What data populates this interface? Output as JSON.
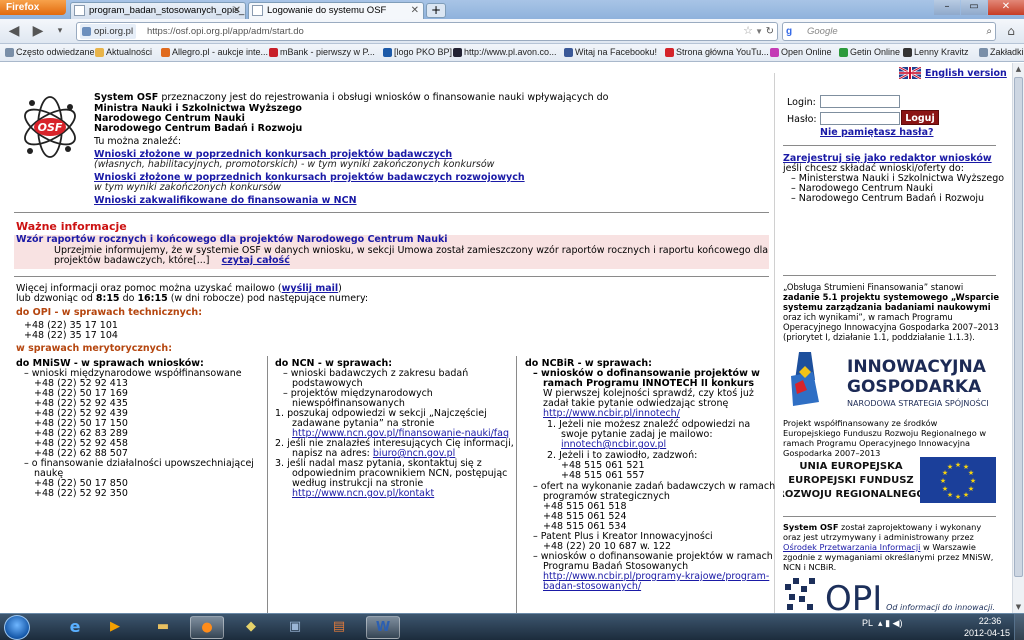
{
  "browser": {
    "app_button": "Firefox",
    "tabs": [
      {
        "label": "program_badan_stosowanych_opis_1...",
        "active": false
      },
      {
        "label": "Logowanie do systemu OSF",
        "active": true
      }
    ],
    "new_tab": "+",
    "url_site": "opi.org.pl",
    "url": "https://osf.opi.org.pl/app/adm/start.do",
    "search_engine": "Google",
    "search_placeholder": "Google",
    "bookmarks": [
      "Często odwiedzane",
      "Aktualności",
      "Allegro.pl - aukcje inte...",
      "mBank - pierwszy w P...",
      "[logo PKO BP]",
      "http://www.pl.avon.co...",
      "Witaj na Facebooku!",
      "Strona główna YouTu...",
      "Open Online",
      "Getin Online",
      "Lenny Kravitz",
      "Zakładki"
    ]
  },
  "page": {
    "language_link": "English version",
    "intro": {
      "line1_bold": "System OSF",
      "line1_rest": " przeznaczony jest do rejestrowania i obsługi wniosków o finansowanie nauki wpływających do",
      "line2": "Ministra Nauki i Szkolnictwa Wyższego",
      "line3": "Narodowego Centrum Nauki",
      "line4": "Narodowego Centrum Badań i Rozwoju",
      "find_label": "Tu można znaleźć:",
      "link1": "Wnioski złożone w poprzednich konkursach projektów badawczych",
      "link1_note": "(własnych, habilitacyjnych, promotorskich) - w tym wyniki zakończonych konkursów",
      "link2": "Wnioski złożone w poprzednich konkursach projektów badawczych rozwojowych",
      "link2_note": "w tym wyniki zakończonych konkursów",
      "link3": "Wnioski zakwalifikowane do finansowania w NCN"
    },
    "login": {
      "login_label": "Login:",
      "login_value": "",
      "password_label": "Hasło:",
      "password_value": "",
      "button": "Loguj",
      "forgot": "Nie pamiętasz hasła?"
    },
    "register": {
      "link": "Zarejestruj się jako redaktor wniosków",
      "text": "jeśli chcesz składać wnioski/oferty do:",
      "items": [
        "Ministerstwa Nauki i Szkolnictwa Wyższego",
        "Narodowego Centrum Nauki",
        "Narodowego Centrum Badań i Rozwoju"
      ]
    },
    "news": {
      "heading": "Ważne informacje",
      "title": "Wzór raportów rocznych i końcowego dla projektów Narodowego Centrum Nauki",
      "text1": "Uprzejmie informujemy, że w systemie OSF w danych wniosku, w sekcji Umowa został zamieszczony wzór raportów rocznych i raportu końcowego dla",
      "text2": "projektów badawczych, które[...]",
      "read_more": "czytaj całość"
    },
    "contact": {
      "line1_pre": "Więcej informacji oraz pomoc można uzyskać mailowo (",
      "mail_link": "wyślij mail",
      "line1_post": ")",
      "line2_pre": "lub dzwoniąc od ",
      "from": "8:15",
      "line2_mid": " do ",
      "to": "16:15",
      "line2_post": " (w dni robocze) pod następujące numery:",
      "tech_heading": "do OPI - w sprawach technicznych:",
      "tech_phones": [
        "+48 (22) 35 17 101",
        "+48 (22) 35 17 104"
      ],
      "merit_heading": "w sprawach merytorycznych:"
    },
    "col_mnisw": {
      "heading": "do MNiSW - w sprawach wniosków:",
      "sub1": "– wnioski międzynarodowe współfinansowane",
      "phones1": [
        "+48 (22) 52 92 413",
        "+48 (22) 50 17 169",
        "+48 (22) 52 92 435",
        "+48 (22) 52 92 439",
        "+48 (22) 50 17 150",
        "+48 (22) 62 83 289",
        "+48 (22) 52 92 458",
        "+48 (22) 62 88 507"
      ],
      "sub2a": "– o finansowanie działalności upowszechniającej",
      "sub2b": "naukę",
      "phones2": [
        "+48 (22) 50 17 850",
        "+48 (22) 52 92 350"
      ]
    },
    "col_ncn": {
      "heading": "do NCN - w sprawach:",
      "lines": [
        "– wnioski badawczych z zakresu badań",
        "podstawowych",
        "– projektów międzynarodowych",
        "niewspółfinansowanych",
        "1.   poszukaj odpowiedzi w sekcji „Najczęściej",
        "zadawane pytania” na stronie"
      ],
      "link_faq": "http://www.ncn.gov.pl/finansowanie-nauki/faq",
      "line2a": "2.   jeśli nie znalazłeś interesujących Cię informacji,",
      "line2b": "napisz na adres: ",
      "mail": "biuro@ncn.gov.pl",
      "line3a": "3.   jeśli nadal masz pytania, skontaktuj się z",
      "line3b": "odpowiednim pracownikiem NCN, postępując",
      "line3c": "według instrukcji na stronie",
      "link_contact": "http://www.ncn.gov.pl/kontakt"
    },
    "col_ncbir": {
      "heading": "do NCBiR - w sprawach:",
      "sub1a": "– wniosków o dofinansowanie projektów w",
      "sub1b": "ramach Programu INNOTECH II konkurs",
      "sub1c": "W pierwszej kolejności sprawdź, czy ktoś już",
      "sub1d": "zadał takie pytanie odwiedzając stronę",
      "link_innotech": "http://www.ncbir.pl/innotech/",
      "step1a": "1.  Jeżeli nie możesz znaleźć odpowiedzi na",
      "step1b": "swoje pytanie zadaj je mailowo:",
      "mail": "innotech@ncbir.gov.pl",
      "step2": "2.  Jeżeli i to zawiodło, zadzwoń:",
      "phones1": [
        "+48 515 061 521",
        "+48 515 061 557"
      ],
      "sub2a": "– ofert na wykonanie zadań badawczych w ramach",
      "sub2b": "programów strategicznych",
      "phones2": [
        "+48 515 061 518",
        "+48 515 061 524",
        "+48 515 061 534"
      ],
      "sub3": "– Patent Plus i Kreator Innowacyjności",
      "phone3": "+48 (22) 20 10 687 w. 122",
      "sub4a": "– wniosków o dofinansowanie projektów w ramach",
      "sub4b": "Programu Badań Stosowanych",
      "link_pbs": "http://www.ncbir.pl/programy-krajowe/program-",
      "link_pbs2": "badan-stosowanych/"
    },
    "sidebar": {
      "p1": [
        "„Obsługa Strumieni Finansowania” stanowi",
        "zadanie 5.1 projektu systemowego „Wsparcie",
        "systemu zarządzania badaniami naukowymi",
        "oraz ich wynikami”, w ramach Programu",
        "Operacyjnego Innowacyjna Gospodarka 2007–2013",
        "(priorytet I, działanie 1.1, poddziałanie 1.1.3)."
      ],
      "ig_logo1": "INNOWACYJNA",
      "ig_logo2": "GOSPODARKA",
      "ig_logo3": "NARODOWA STRATEGIA SPÓJNOŚCI",
      "p2": [
        "Projekt współfinansowany ze środków",
        "Europejskiego Funduszu Rozwoju Regionalnego w",
        "ramach Programu Operacyjnego Innowacyjna",
        "Gospodarka 2007–2013"
      ],
      "eu1": "UNIA EUROPEJSKA",
      "eu2": "EUROPEJSKI FUNDUSZ",
      "eu3": "ROZWOJU REGIONALNEGO",
      "p3_bold": "System OSF",
      "p3": [
        " został zaprojektowany i wykonany",
        "oraz jest utrzymywany i administrowany przez"
      ],
      "opi_link": "Ośrodek Przetwarzania Informacji",
      "p3b": [
        " w Warszawie",
        "zgodnie z wymaganiami określanymi przez MNiSW,",
        "NCN i NCBiR."
      ],
      "opi_logo": "OPI",
      "opi_tagline": "Od informacji do innowacji."
    }
  },
  "taskbar": {
    "lang": "PL",
    "time": "22:36",
    "date": "2012-04-15"
  },
  "colors": {
    "accent_red": "#8a1414",
    "news_bg": "#f8e2e2",
    "link": "#1a1aa6",
    "orange_heading": "#b5460f"
  }
}
